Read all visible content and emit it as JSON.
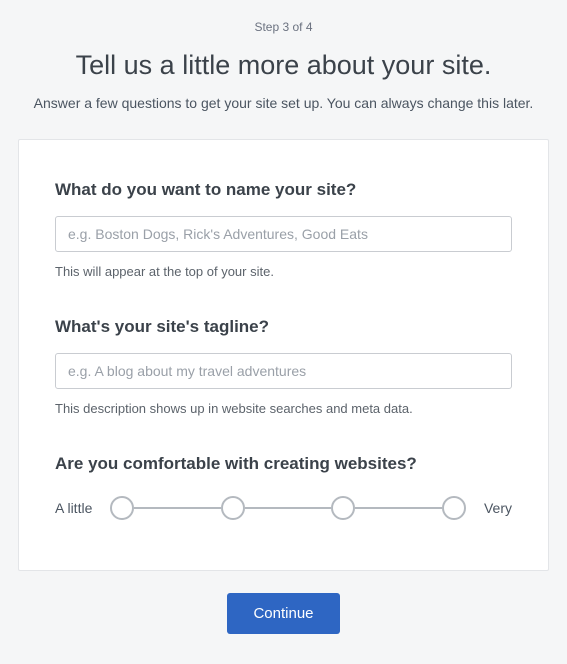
{
  "step_label": "Step 3 of 4",
  "title": "Tell us a little more about your site.",
  "subtitle": "Answer a few questions to get your site set up. You can always change this later.",
  "fields": {
    "site_name": {
      "question": "What do you want to name your site?",
      "placeholder": "e.g. Boston Dogs, Rick's Adventures, Good Eats",
      "value": "",
      "hint": "This will appear at the top of your site."
    },
    "tagline": {
      "question": "What's your site's tagline?",
      "placeholder": "e.g. A blog about my travel adventures",
      "value": "",
      "hint": "This description shows up in website searches and meta data."
    },
    "comfort": {
      "question": "Are you comfortable with creating websites?",
      "min_label": "A little",
      "max_label": "Very",
      "steps": 4
    }
  },
  "continue_label": "Continue"
}
